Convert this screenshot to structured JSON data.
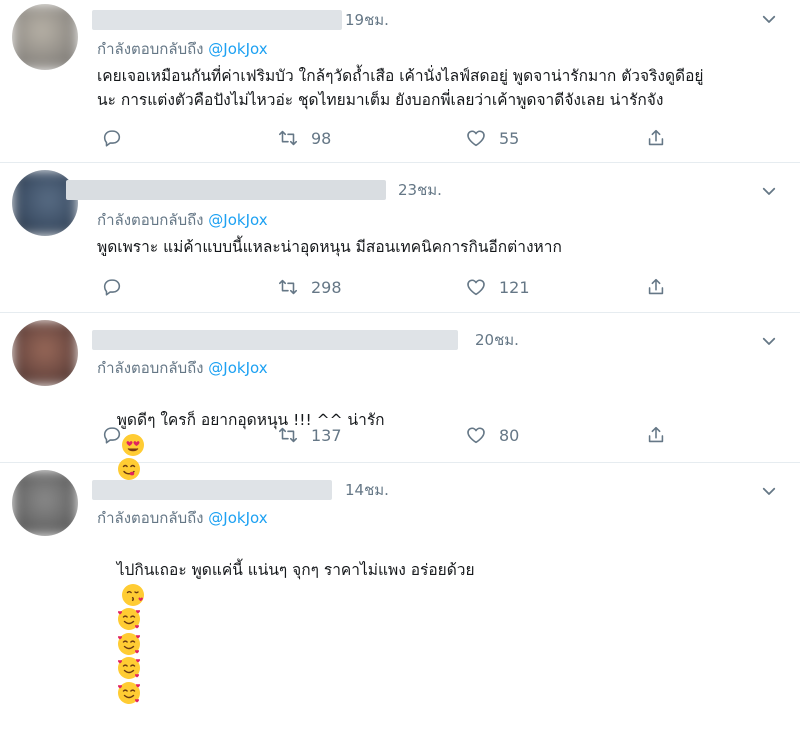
{
  "tweets": [
    {
      "time": "19ชม.",
      "reply_prefix": "กำลังตอบกลับถึง",
      "reply_handle": "@JokJox",
      "text": "เคยเจอเหมือนกันที่ค่าเฟริมบัว ใกล้ๆวัดถ้ำเสือ เค้านั่งไลฟ์สดอยู่ พูดจาน่ารักมาก ตัวจริงดูดีอยู่\nนะ การแต่งตัวคือปังไม่ไหวอ่ะ ชุดไทยมาเต็ม ยังบอกพี่เลยว่าเค้าพูดจาดีจังเลย น่ารักจัง",
      "retweets": "98",
      "likes": "55"
    },
    {
      "time": "23ชม.",
      "reply_prefix": "กำลังตอบกลับถึง",
      "reply_handle": "@JokJox",
      "text": "พูดเพราะ แม่ค้าแบบนี้แหละน่าอุดหนุน มีสอนเทคนิคการกินอีกต่างหาก",
      "retweets": "298",
      "likes": "121"
    },
    {
      "time": "20ชม.",
      "reply_prefix": "กำลังตอบกลับถึง",
      "reply_handle": "@JokJox",
      "text": "พูดดีๆ ใครก็ อยากอุดหนุน !!! ^^ น่ารัก",
      "retweets": "137",
      "likes": "80"
    },
    {
      "time": "14ชม.",
      "reply_prefix": "กำลังตอบกลับถึง",
      "reply_handle": "@JokJox",
      "text": "ไปกินเถอะ พูดแค่นี้ แน่นๆ จุกๆ ราคาไม่แพง อร่อยด้วย"
    }
  ],
  "colors": {
    "link": "#1da1f2",
    "muted": "#657786",
    "divider": "#e6ecf0"
  }
}
